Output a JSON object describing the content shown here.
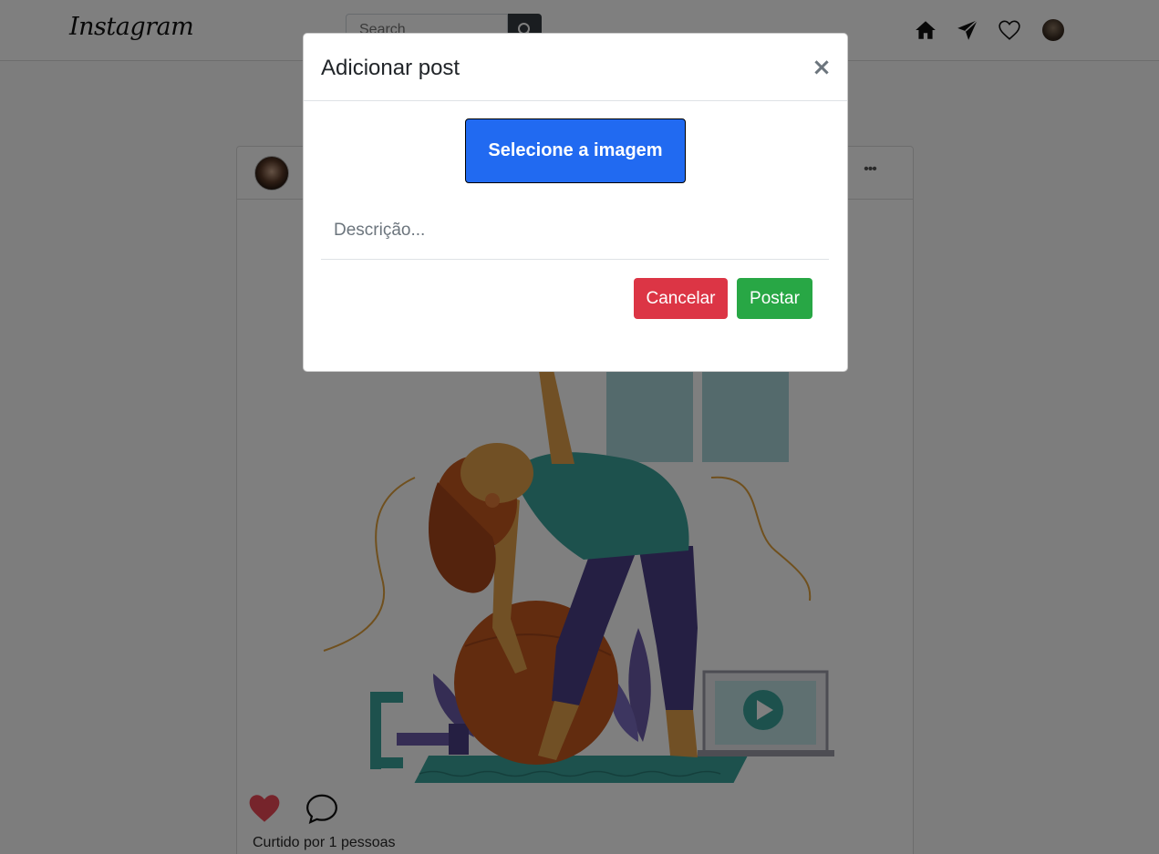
{
  "header": {
    "logo": "Instagram",
    "search_placeholder": "Search"
  },
  "nav_icons": [
    "home-icon",
    "direct-message-icon",
    "heart-icon",
    "profile-avatar"
  ],
  "post": {
    "more_label": "•••",
    "likes_text": "Curtido por 1 pessoas"
  },
  "modal": {
    "title": "Adicionar post",
    "close_label": "×",
    "select_image_label": "Selecione a imagem",
    "description_placeholder": "Descrição...",
    "cancel_label": "Cancelar",
    "post_label": "Postar"
  },
  "colors": {
    "primary_button": "#216af1",
    "cancel_button": "#dc3545",
    "post_button": "#28a745",
    "like_heart": "#ed4956"
  }
}
